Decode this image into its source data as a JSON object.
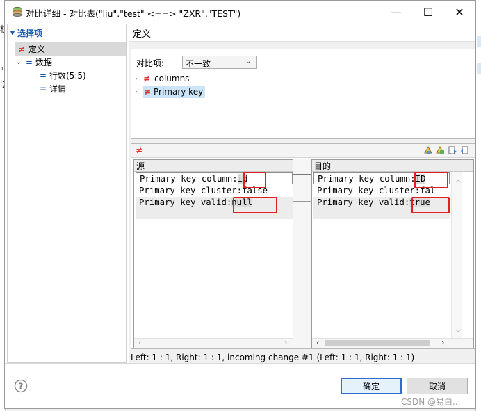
{
  "window": {
    "title": "对比详细 - 对比表(\"liu\".\"test\" <==> \"ZXR\".\"TEST\")",
    "controls": {
      "minimize": "—",
      "maximize": "☐",
      "close": "✕"
    }
  },
  "background_app": {
    "left_fragments": [
      "权",
      "\"",
      "'Z"
    ],
    "right_accent": "#dbe8f6"
  },
  "sidebar": {
    "header": "选择项",
    "items": [
      {
        "label": "定义",
        "icon": "not-equal-icon",
        "selected": true
      },
      {
        "label": "数据",
        "icon": "equals-icon",
        "expanded": true
      },
      {
        "label": "行数(5:5)",
        "icon": "equals-icon"
      },
      {
        "label": "详情",
        "icon": "equals-icon"
      }
    ]
  },
  "main": {
    "header": "定义",
    "compare_label": "对比项:",
    "compare_value": "不一致",
    "tree": [
      {
        "label": "columns",
        "icon": "not-equal-icon",
        "selected": false
      },
      {
        "label": "Primary key",
        "icon": "not-equal-icon",
        "selected": true
      }
    ]
  },
  "diff": {
    "toolbar_icon": "not-equal-icon",
    "left_header": "源",
    "right_header": "目的",
    "left_lines": [
      {
        "prefix": "Primary key column:",
        "value": "id"
      },
      {
        "prefix": "Primary key cluster:false",
        "value": ""
      },
      {
        "prefix": "Primary key valid:",
        "value": "null"
      }
    ],
    "right_lines": [
      {
        "prefix": "Primary key column:",
        "value": "ID"
      },
      {
        "prefix": "Primary key cluster:fal",
        "value": ""
      },
      {
        "prefix": "Primary key valid:",
        "value": "true"
      }
    ],
    "status": "Left: 1 : 1, Right: 1 : 1, incoming change #1 (Left: 1 : 1, Right: 1 : 1)"
  },
  "footer": {
    "help_icon": "help-icon",
    "ok_label": "确定",
    "cancel_label": "取消",
    "watermark": "CSDN @易白..."
  },
  "colors": {
    "accent": "#1a5fb4",
    "diff_red": "#e02020",
    "not_equal": "#e03030",
    "equals_icon": "#1f5aa6"
  }
}
